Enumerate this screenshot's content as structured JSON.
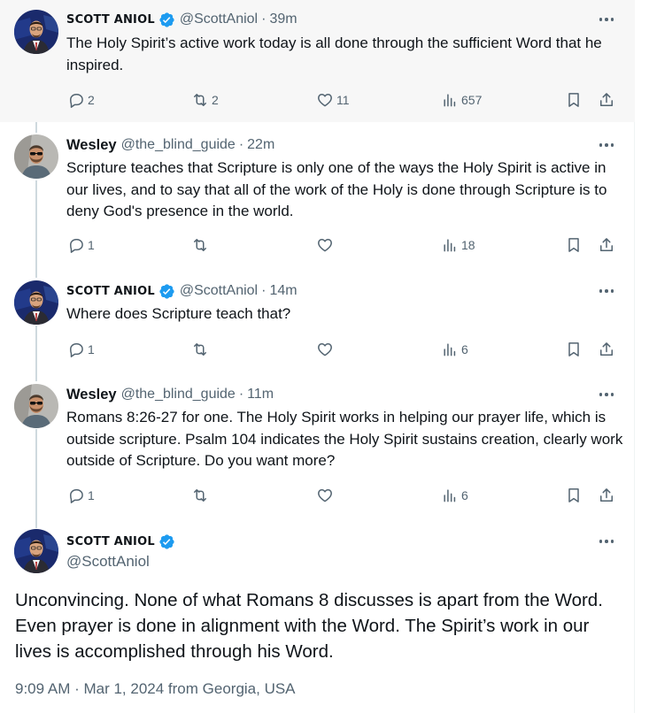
{
  "colors": {
    "accent": "#1d9bf0",
    "muted": "#536471",
    "line": "#cfd9de"
  },
  "tweets": [
    {
      "name": "SCOTT ANIOL",
      "handle": "@ScottAniol",
      "dot": "·",
      "time": "39m",
      "text": "The Holy Spirit’s active work today is all done through the sufficient Word that he inspired.",
      "replies": "2",
      "reposts": "2",
      "likes": "11",
      "views": "657"
    },
    {
      "name": "Wesley",
      "handle": "@the_blind_guide",
      "dot": "·",
      "time": "22m",
      "text": "Scripture teaches that Scripture is only one of the ways the Holy Spirit is active in our lives, and to say that all of the work of the Holy is done through Scripture is to deny God's presence in the world.",
      "replies": "1",
      "reposts": "",
      "likes": "",
      "views": "18"
    },
    {
      "name": "SCOTT ANIOL",
      "handle": "@ScottAniol",
      "dot": "·",
      "time": "14m",
      "text": "Where does Scripture teach that?",
      "replies": "1",
      "reposts": "",
      "likes": "",
      "views": "6"
    },
    {
      "name": "Wesley",
      "handle": "@the_blind_guide",
      "dot": "·",
      "time": "11m",
      "text": "Romans 8:26-27 for one. The Holy Spirit works in helping our prayer life, which is outside scripture. Psalm 104 indicates the Holy Spirit sustains creation, clearly work outside of Scripture. Do you want more?",
      "replies": "1",
      "reposts": "",
      "likes": "",
      "views": "6"
    }
  ],
  "main": {
    "name": "SCOTT ANIOL",
    "handle": "@ScottAniol",
    "text": "Unconvincing. None of what Romans 8 discusses is apart from the Word. Even prayer is done in alignment with the Word. The Spirit’s work in our lives is accomplished through his Word.",
    "meta": "9:09 AM · Mar 1, 2024 from Georgia, USA"
  },
  "icons": [
    "reply-icon",
    "repost-icon",
    "like-icon",
    "views-icon",
    "bookmark-icon",
    "share-icon",
    "more-icon",
    "verified-icon"
  ]
}
